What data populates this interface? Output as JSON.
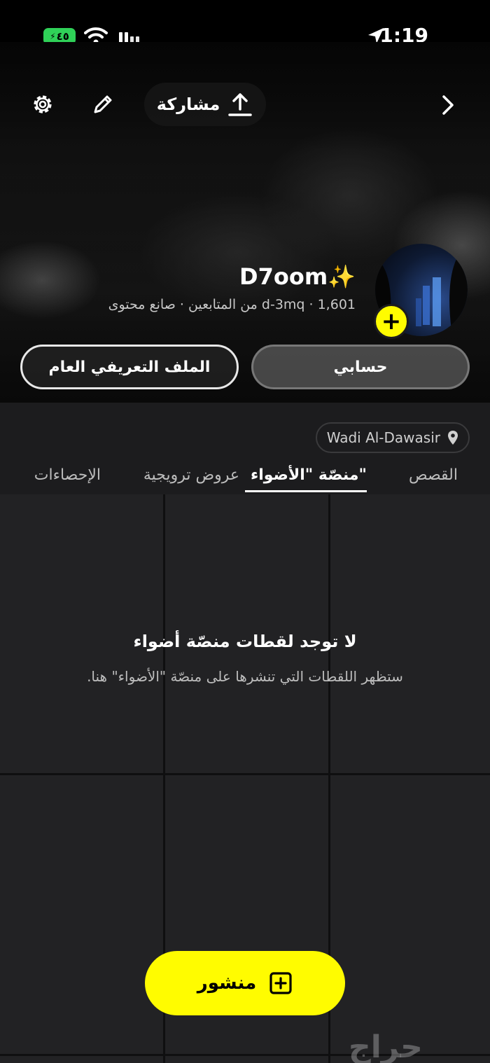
{
  "status_bar": {
    "battery": "٤٥",
    "time": "1:19"
  },
  "header": {
    "share_label": "مشاركة"
  },
  "profile": {
    "display_name": "D7oom✨",
    "sub_line": "d-3mq · 1,601 من المتابعين · صانع محتوى",
    "buttons": {
      "my_account": "حسابي",
      "public_profile": "الملف التعريفي العام"
    },
    "location": "Wadi Al-Dawasir"
  },
  "tabs": [
    {
      "label": "القصص"
    },
    {
      "label": "منصّة \"الأضواء\"",
      "active": true
    },
    {
      "label": "عروض ترويجية"
    },
    {
      "label": "الإحصاءات"
    }
  ],
  "empty_state": {
    "title": "لا توجد لقطات منصّة أضواء",
    "description": "ستظهر اللقطات التي تنشرها على منصّة \"الأضواء\" هنا."
  },
  "post_button": {
    "label": "منشور"
  },
  "watermark": "حراج",
  "colors": {
    "accent_yellow": "#fffc00",
    "background": "#1c1c1e",
    "battery_green": "#2fd158"
  },
  "icons": [
    "settings-icon",
    "edit-pencil-icon",
    "share-upload-icon",
    "chevron-right-icon",
    "location-pin-icon",
    "add-plus-icon",
    "wifi-icon",
    "signal-icon",
    "location-arrow-icon"
  ]
}
